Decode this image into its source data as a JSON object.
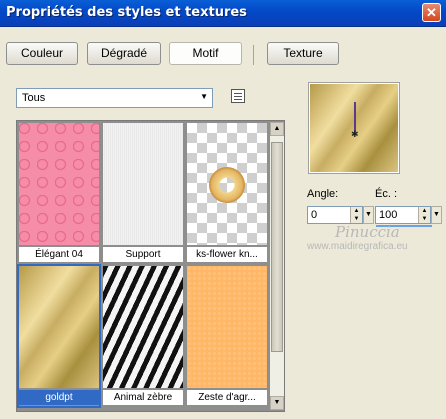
{
  "window": {
    "title": "Propriétés des styles et textures",
    "close_glyph": "✕"
  },
  "tabs": [
    {
      "label": "Couleur",
      "active": false
    },
    {
      "label": "Dégradé",
      "active": false
    },
    {
      "label": "Motif",
      "active": true
    },
    {
      "label": "Texture",
      "active": false
    }
  ],
  "category_select": {
    "value": "Tous",
    "arrow": "▼"
  },
  "view_icon": "list-view-icon",
  "patterns": [
    {
      "name": "Élégant 04",
      "swatch": "pink-swirl",
      "selected": false
    },
    {
      "name": "Support",
      "swatch": "white-linen",
      "selected": false
    },
    {
      "name": "ks-flower kn...",
      "swatch": "transparent-donut",
      "selected": false
    },
    {
      "name": "goldpt",
      "swatch": "gold",
      "selected": true
    },
    {
      "name": "Animal zèbre",
      "swatch": "zebra",
      "selected": false
    },
    {
      "name": "Zeste d'agr...",
      "swatch": "orange-zest",
      "selected": false
    }
  ],
  "scrollbar": {
    "up": "▲",
    "down": "▼"
  },
  "preview": {
    "pivot": "✱"
  },
  "angle": {
    "label": "Angle:",
    "value": "0"
  },
  "scale": {
    "label": "Éc. :",
    "value": "100"
  },
  "spin_glyphs": {
    "up": "▲",
    "down": "▼",
    "dropdown": "▼"
  },
  "watermark": {
    "line1": "Pinuccia",
    "line2": "www.maidiregrafica.eu"
  },
  "colors": {
    "titlebar": "#0348c8",
    "selection": "#316ac5",
    "dialog_bg": "#ece9d8"
  }
}
